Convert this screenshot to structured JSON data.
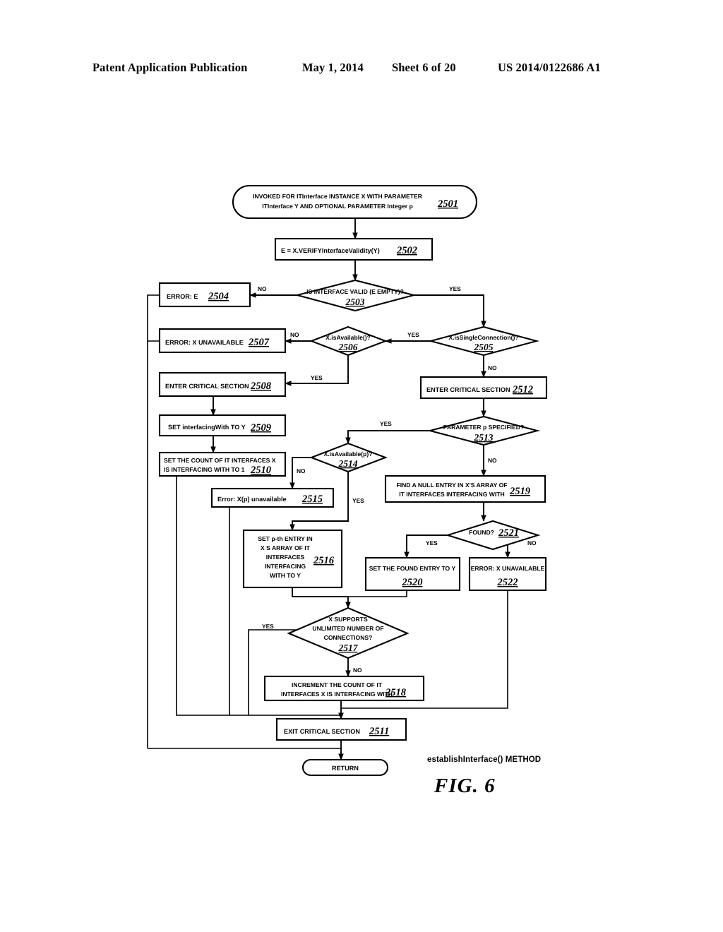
{
  "header": {
    "title": "Patent Application Publication",
    "date": "May 1, 2014",
    "sheet": "Sheet 6 of 20",
    "publication": "US 2014/0122686 A1"
  },
  "figure": {
    "method_label": "establishInterface() METHOD",
    "fig_number": "FIG.  6"
  },
  "nodes": {
    "n2501": {
      "ref": "2501",
      "shape": "terminator",
      "line1": "INVOKED FOR ITInterface INSTANCE X WITH PARAMETER",
      "line2": "ITInterface Y AND OPTIONAL PARAMETER Integer p"
    },
    "n2502": {
      "ref": "2502",
      "shape": "process",
      "line1": "E = X.VERIFYInterfaceValidity(Y)"
    },
    "n2503": {
      "ref": "2503",
      "shape": "decision",
      "line1": "IS INTERFACE VALID (E EMPTY)?"
    },
    "n2504": {
      "ref": "2504",
      "shape": "process",
      "line1": "ERROR:  E"
    },
    "n2505": {
      "ref": "2505",
      "shape": "decision",
      "line1": "X.isSingleConnection()?"
    },
    "n2506": {
      "ref": "2506",
      "shape": "decision",
      "line1": "X.isAvailable()?"
    },
    "n2507": {
      "ref": "2507",
      "shape": "process",
      "line1": "ERROR:  X UNAVAILABLE"
    },
    "n2508": {
      "ref": "2508",
      "shape": "process",
      "line1": "ENTER CRITICAL SECTION"
    },
    "n2509": {
      "ref": "2509",
      "shape": "process",
      "line1": "SET interfacingWith TO Y"
    },
    "n2510": {
      "ref": "2510",
      "shape": "process",
      "line1": "SET THE COUNT OF IT INTERFACES X",
      "line2": "IS INTERFACING WITH TO 1"
    },
    "n2511": {
      "ref": "2511",
      "shape": "process",
      "line1": "EXIT CRITICAL SECTION"
    },
    "n2512": {
      "ref": "2512",
      "shape": "process",
      "line1": "ENTER CRITICAL SECTION"
    },
    "n2513": {
      "ref": "2513",
      "shape": "decision",
      "line1": "PARAMETER p SPECIFIED?"
    },
    "n2514": {
      "ref": "2514",
      "shape": "decision",
      "line1": "X.isAvailable(p)?"
    },
    "n2515": {
      "ref": "2515",
      "shape": "process",
      "line1": "Error:  X(p) unavailable"
    },
    "n2516": {
      "ref": "2516",
      "shape": "process",
      "line1": "SET p-th ENTRY IN",
      "line2": "X S ARRAY OF IT",
      "line3": "INTERFACES",
      "line4": "INTERFACING",
      "line5": "WITH TO Y"
    },
    "n2517": {
      "ref": "2517",
      "shape": "decision",
      "line1": "X SUPPORTS",
      "line2": "UNLIMITED NUMBER OF",
      "line3": "CONNECTIONS?"
    },
    "n2518": {
      "ref": "2518",
      "shape": "process",
      "line1": "INCREMENT THE COUNT OF IT",
      "line2": "INTERFACES X IS INTERFACING WITH"
    },
    "n2519": {
      "ref": "2519",
      "shape": "process",
      "line1": "FIND A NULL ENTRY IN X'S ARRAY OF",
      "line2": "IT INTERFACES INTERFACING WITH"
    },
    "n2520": {
      "ref": "2520",
      "shape": "process",
      "line1": "SET THE FOUND ENTRY TO Y"
    },
    "n2521": {
      "ref": "2521",
      "shape": "decision",
      "line1": "FOUND?"
    },
    "n2522": {
      "ref": "2522",
      "shape": "process",
      "line1": "ERROR:  X UNAVAILABLE"
    },
    "nreturn": {
      "ref": "",
      "shape": "terminator",
      "line1": "RETURN"
    }
  },
  "edge_labels": {
    "e2503_no": "NO",
    "e2503_yes": "YES",
    "e2506_no": "NO",
    "e2506_yes": "YES",
    "e2505_yes": "YES",
    "e2505_no": "NO",
    "e2513_yes": "YES",
    "e2513_no": "NO",
    "e2514_no": "NO",
    "e2514_yes": "YES",
    "e2521_yes": "YES",
    "e2521_no": "NO",
    "e2517_yes": "YES",
    "e2517_no": "NO"
  },
  "colors": {
    "ink": "#000000",
    "paper": "#ffffff"
  }
}
